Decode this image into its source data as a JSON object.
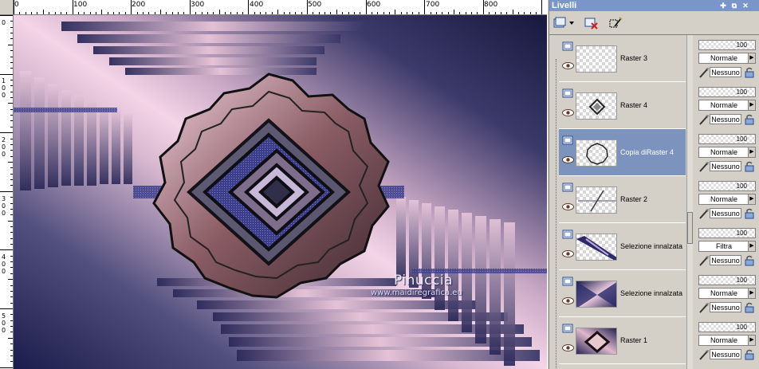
{
  "ruler": {
    "h_labels": [
      "0",
      "100",
      "200",
      "300",
      "400",
      "500",
      "600",
      "700",
      "800"
    ],
    "v_labels": [
      [
        "0"
      ],
      [
        "1",
        "0",
        "0"
      ],
      [
        "2",
        "0",
        "0"
      ],
      [
        "3",
        "0",
        "0"
      ],
      [
        "4",
        "0",
        "0"
      ],
      [
        "5",
        "0",
        "0"
      ]
    ]
  },
  "canvas": {
    "watermark_name": "Pinuccia",
    "watermark_url": "www.maidiregrafica.eu"
  },
  "panel": {
    "title": "Livelli"
  },
  "toolbar": {
    "buttons": [
      "new-layer-icon",
      "delete-layer-icon",
      "edit-selection-icon"
    ]
  },
  "layers": [
    {
      "name": "Raster 3",
      "opacity": "100",
      "blend": "Normale",
      "mask": "Nessuno",
      "selected": false
    },
    {
      "name": "Raster 4",
      "opacity": "100",
      "blend": "Normale",
      "mask": "Nessuno",
      "selected": false
    },
    {
      "name": "Copia diRaster 4",
      "opacity": "100",
      "blend": "Normale",
      "mask": "Nessuno",
      "selected": true
    },
    {
      "name": "Raster 2",
      "opacity": "100",
      "blend": "Normale",
      "mask": "Nessuno",
      "selected": false
    },
    {
      "name": "Selezione innalzata",
      "opacity": "100",
      "blend": "Filtra",
      "mask": "Nessuno",
      "selected": false
    },
    {
      "name": "Selezione innalzata",
      "opacity": "100",
      "blend": "Normale",
      "mask": "Nessuno",
      "selected": false
    },
    {
      "name": "Raster 1",
      "opacity": "100",
      "blend": "Normale",
      "mask": "Nessuno",
      "selected": false
    }
  ],
  "colors": {
    "title_bar": "#7a96c9",
    "selected_row": "#7c94bd",
    "canvas_navy": "#1a1a48",
    "canvas_pink": "#f0c8dc"
  }
}
